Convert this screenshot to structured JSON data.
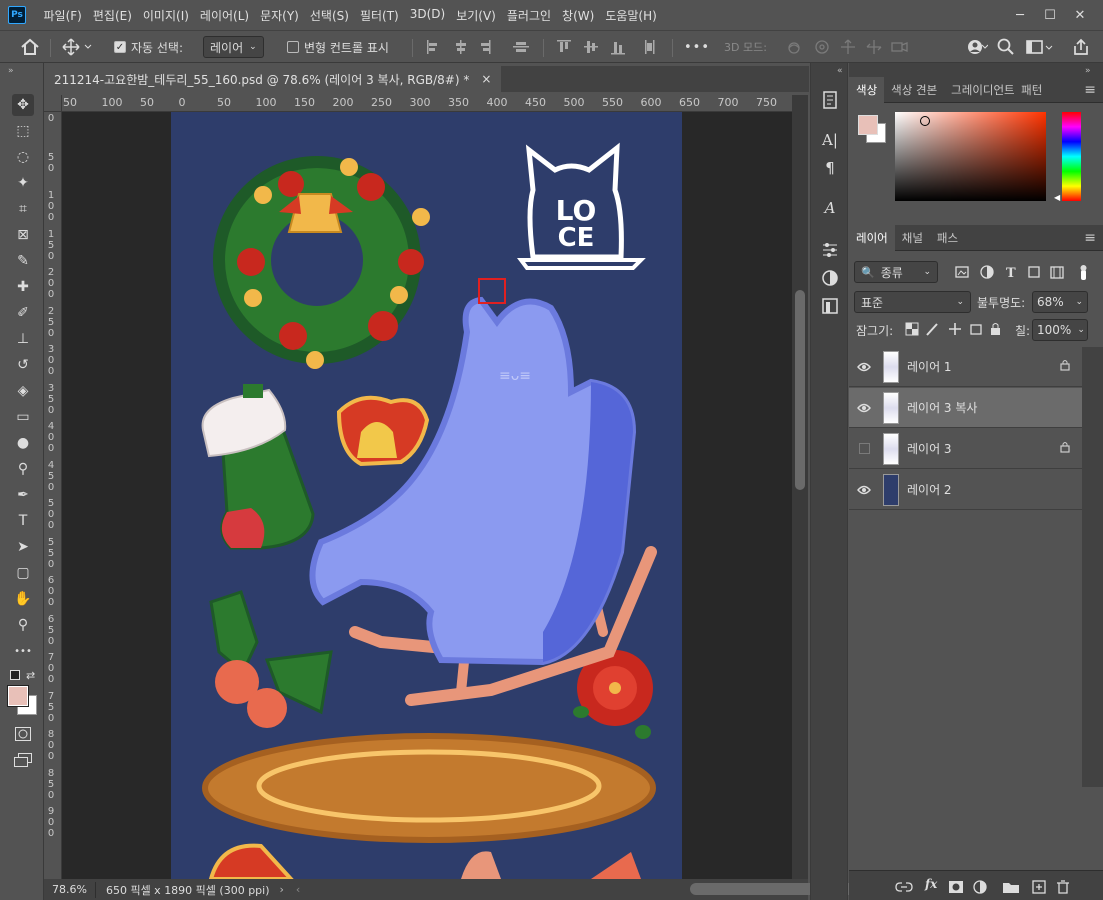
{
  "app": {
    "logo": "Ps"
  },
  "menu": [
    "파일(F)",
    "편집(E)",
    "이미지(I)",
    "레이어(L)",
    "문자(Y)",
    "선택(S)",
    "필터(T)",
    "3D(D)",
    "보기(V)",
    "플러그인",
    "창(W)",
    "도움말(H)"
  ],
  "window_controls": {
    "minimize": "─",
    "maximize": "☐",
    "close": "✕"
  },
  "options": {
    "auto_select_label": "자동 선택:",
    "auto_select_target": "레이어",
    "transform_controls_label": "변형 컨트롤 표시",
    "more": "•••",
    "mode_3d": "3D 모드:"
  },
  "tools": [
    "move-tool",
    "marquee-tool",
    "lasso-tool",
    "magic-wand-tool",
    "crop-tool",
    "frame-tool",
    "eyedropper-tool",
    "healing-brush-tool",
    "brush-tool",
    "clone-stamp-tool",
    "history-brush-tool",
    "eraser-tool",
    "gradient-tool",
    "blur-tool",
    "dodge-tool",
    "pen-tool",
    "type-tool",
    "path-selection-tool",
    "rectangle-tool",
    "hand-tool",
    "zoom-tool",
    "more-tools"
  ],
  "document": {
    "tab_title": "211214-고요한밤_테두리_55_160.psd @ 78.6% (레이어 3 복사, RGB/8#) *",
    "close": "×",
    "zoom": "78.6%",
    "info": "650 픽셀 x 1890 픽셀 (300 ppi)"
  },
  "ruler_top": [
    "50",
    "100",
    "50",
    "0",
    "50",
    "100",
    "150",
    "200",
    "250",
    "300",
    "350",
    "400",
    "450",
    "500",
    "550",
    "600",
    "650",
    "700",
    "750"
  ],
  "ruler_left": [
    "0",
    "5\n0",
    "1\n0\n0",
    "1\n5\n0",
    "2\n0\n0",
    "2\n5\n0",
    "3\n0\n0",
    "3\n5\n0",
    "4\n0\n0",
    "4\n5\n0",
    "5\n0\n0",
    "5\n5\n0",
    "6\n0\n0",
    "6\n5\n0",
    "7\n0\n0",
    "7\n5\n0",
    "8\n0\n0",
    "8\n5\n0",
    "9\n0\n0"
  ],
  "artwork": {
    "logo_letters": [
      "L",
      "O",
      "C",
      "E"
    ]
  },
  "color_panel": {
    "tabs": [
      "색상",
      "색상 견본",
      "그레이디언트",
      "패턴"
    ],
    "foreground": "#e8c0b8",
    "background": "#ffffff",
    "field_hue": "#ff3300"
  },
  "layers_panel": {
    "tabs": [
      "레이어",
      "채널",
      "패스"
    ],
    "filter_kind": "종류",
    "blend_mode": "표준",
    "opacity_label": "불투명도:",
    "opacity_value": "68%",
    "lock_label": "잠그기:",
    "fill_label": "칠:",
    "fill_value": "100%",
    "layers": [
      {
        "name": "레이어 1",
        "visible": true,
        "locked": true,
        "selected": false
      },
      {
        "name": "레이어 3 복사",
        "visible": true,
        "locked": false,
        "selected": true
      },
      {
        "name": "레이어 3",
        "visible": false,
        "locked": true,
        "selected": false
      },
      {
        "name": "레이어 2",
        "visible": true,
        "locked": false,
        "selected": false
      }
    ],
    "footer_icons": [
      "link-icon",
      "fx-icon",
      "mask-icon",
      "adjustment-icon",
      "folder-icon",
      "new-layer-icon",
      "trash-icon"
    ],
    "footer_fx": "fx"
  },
  "colors": {
    "artboard": "#2e3d6b",
    "selection_rect": "#e02020",
    "sled": "#8b9af0"
  }
}
